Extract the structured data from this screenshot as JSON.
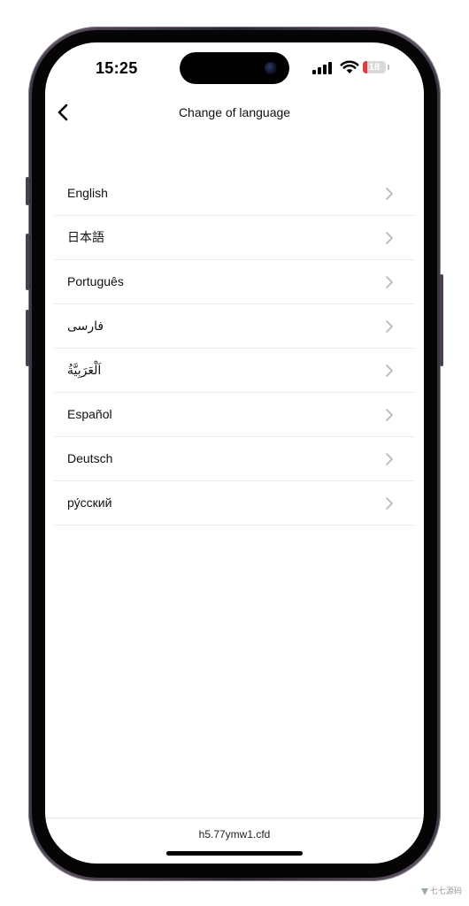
{
  "status_bar": {
    "time": "15:25",
    "battery_level": "18",
    "battery_fraction": 0.18,
    "battery_color": "#e23b3b"
  },
  "header": {
    "back_icon": "chevron-left-icon",
    "title": "Change of language"
  },
  "languages": [
    {
      "label": "English"
    },
    {
      "label": "日本語"
    },
    {
      "label": "Português"
    },
    {
      "label": "فارسی"
    },
    {
      "label": "اَلْعَرَبِيَّةُ"
    },
    {
      "label": "Español"
    },
    {
      "label": "Deutsch"
    },
    {
      "label": "ру́сский"
    }
  ],
  "footer": {
    "url": "h5.77ymw1.cfd"
  },
  "watermark": {
    "text": "七七源码"
  }
}
